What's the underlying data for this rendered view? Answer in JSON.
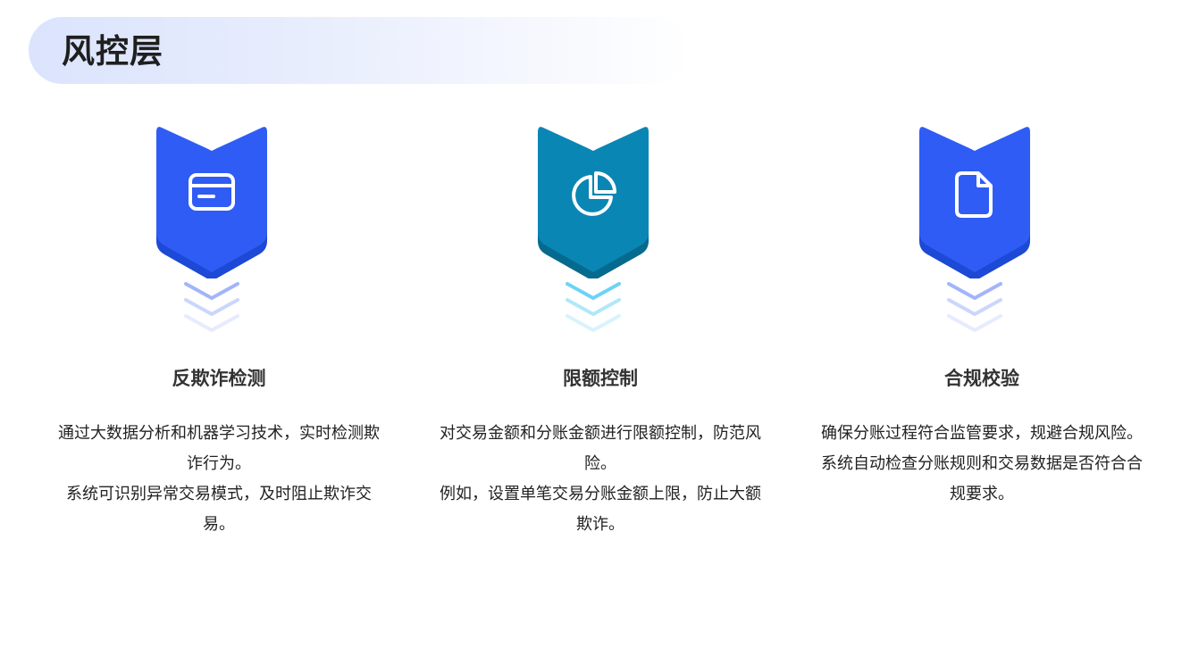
{
  "header": {
    "title": "风控层"
  },
  "colors": {
    "blue": "#2f5cf5",
    "teal": "#0a86b4",
    "header_bg": "#dbe4fd"
  },
  "cards": [
    {
      "icon": "credit-card-icon",
      "color": "blue",
      "title": "反欺诈检测",
      "desc_lines": [
        "通过大数据分析和机器学习技术，实时检测欺诈行为。",
        "系统可识别异常交易模式，及时阻止欺诈交易。"
      ]
    },
    {
      "icon": "pie-chart-icon",
      "color": "teal",
      "title": "限额控制",
      "desc_lines": [
        "对交易金额和分账金额进行限额控制，防范风险。",
        "例如，设置单笔交易分账金额上限，防止大额欺诈。"
      ]
    },
    {
      "icon": "document-icon",
      "color": "blue",
      "title": "合规校验",
      "desc_lines": [
        "确保分账过程符合监管要求，规避合规风险。",
        "系统自动检查分账规则和交易数据是否符合合规要求。"
      ]
    }
  ]
}
